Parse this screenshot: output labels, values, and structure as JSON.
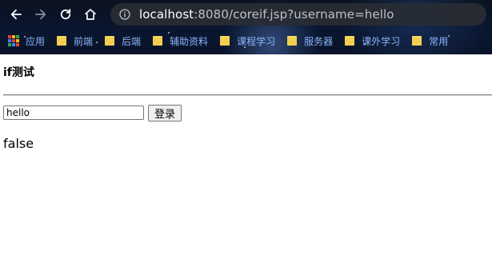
{
  "browser": {
    "url": {
      "host": "localhost",
      "rest": ":8080/coreif.jsp?username=hello"
    },
    "bookmarks": [
      {
        "label": "应用",
        "icon": "apps-grid-icon"
      },
      {
        "label": "前端",
        "icon": "folder-icon"
      },
      {
        "label": "后端",
        "icon": "folder-icon"
      },
      {
        "label": "辅助资料",
        "icon": "folder-icon"
      },
      {
        "label": "课程学习",
        "icon": "folder-icon"
      },
      {
        "label": "服务器",
        "icon": "folder-icon"
      },
      {
        "label": "课外学习",
        "icon": "folder-icon"
      },
      {
        "label": "常用",
        "icon": "folder-icon"
      }
    ],
    "nav": [
      "back-arrow-icon",
      "forward-arrow-icon",
      "reload-icon",
      "home-icon",
      "info-icon"
    ]
  },
  "page": {
    "title": "if测试",
    "form": {
      "username_value": "hello",
      "submit_label": "登录"
    },
    "result_text": "false"
  },
  "colors": {
    "chrome_bg": "#0a1630",
    "omnibox_bg": "#282c34",
    "bookmark_text": "#8ab4f8",
    "url_host": "#ffffff",
    "url_rest": "#bdc1c6"
  }
}
